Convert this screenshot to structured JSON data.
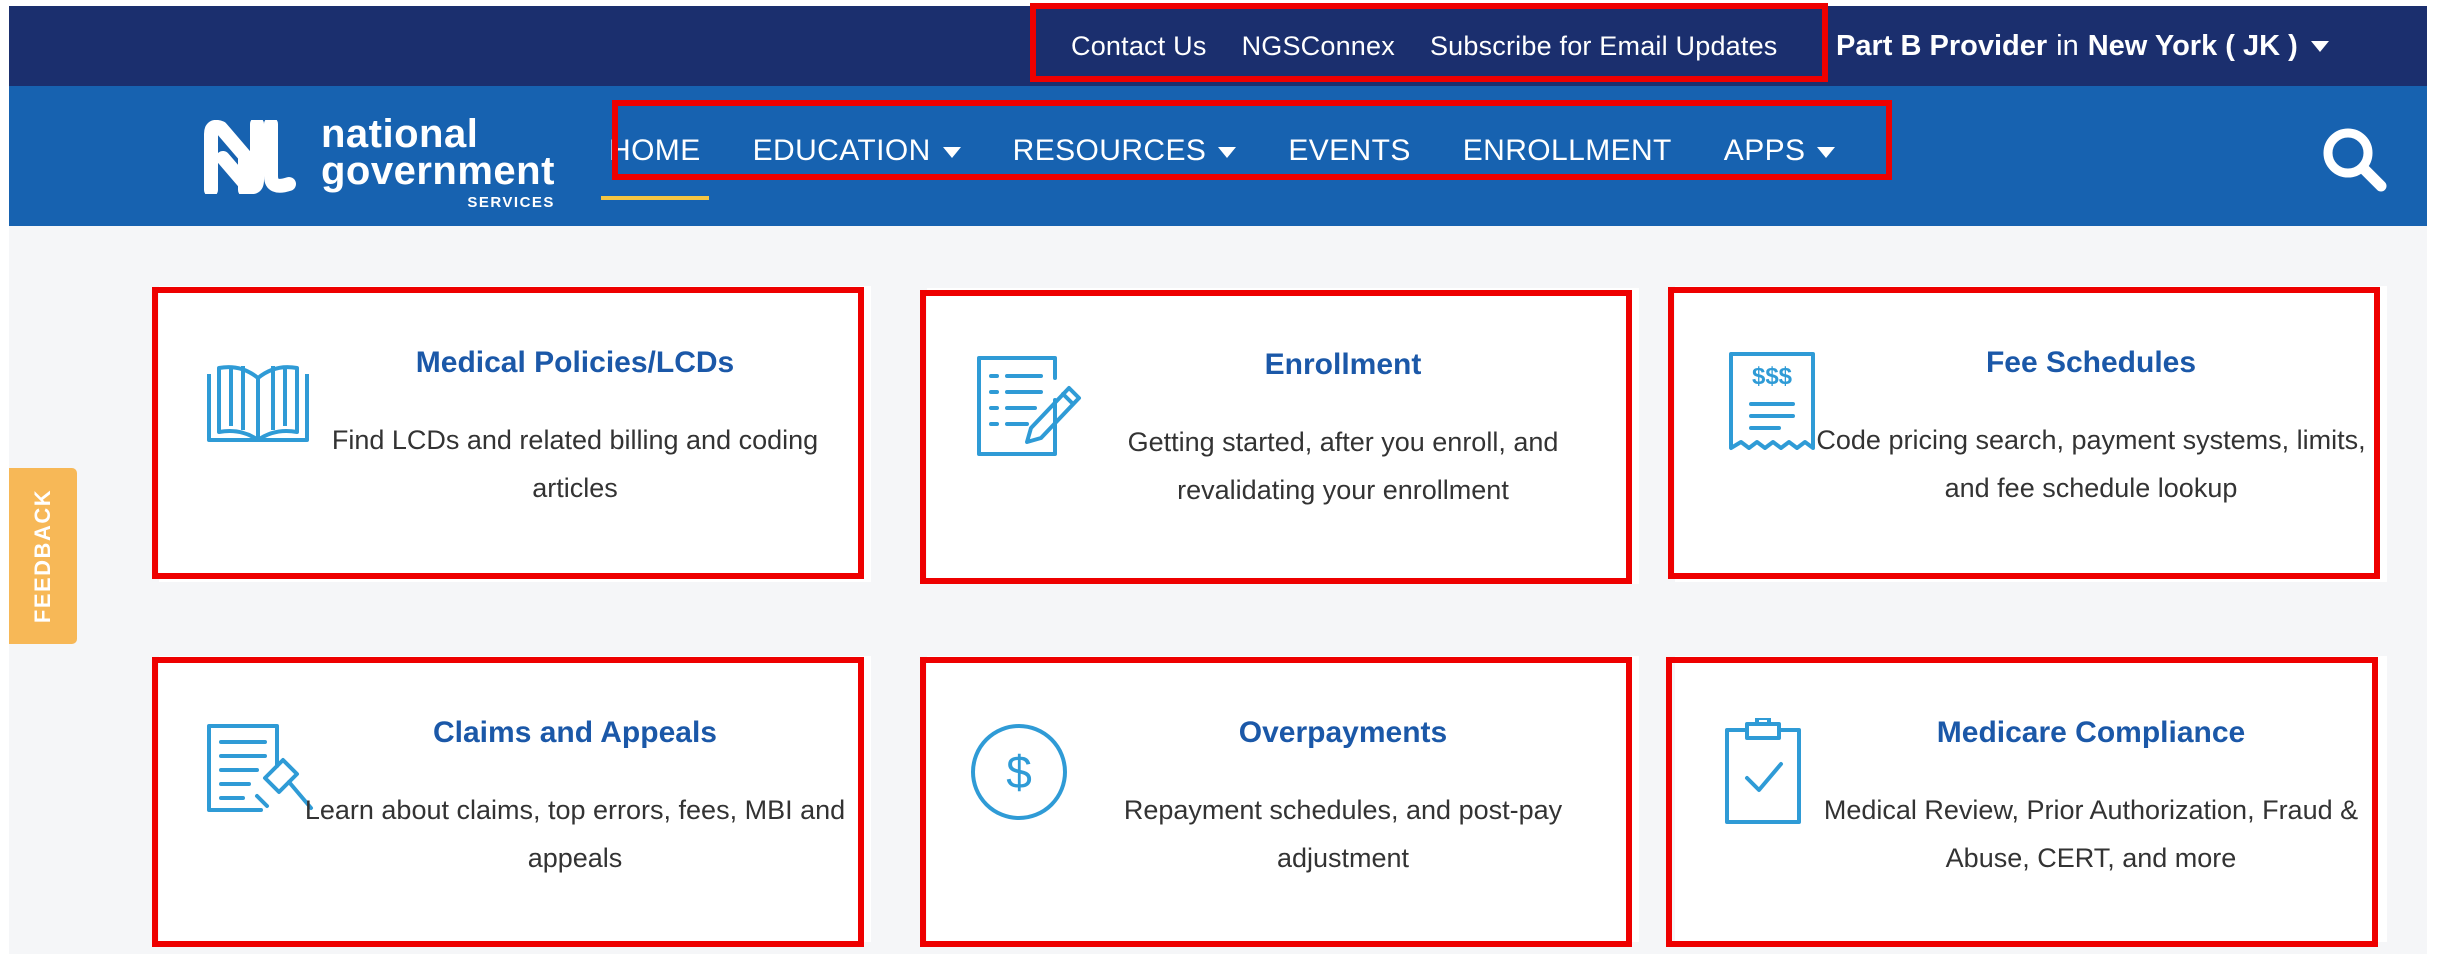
{
  "top_links": [
    "Contact Us",
    "NGSConnex",
    "Subscribe for Email Updates"
  ],
  "provider": {
    "role": "Part B Provider",
    "in_word": "in",
    "region": "New York ( JK )"
  },
  "logo": {
    "line1": "national",
    "line2": "government",
    "line3": "SERVICES"
  },
  "nav": [
    "HOME",
    "EDUCATION",
    "RESOURCES",
    "EVENTS",
    "ENROLLMENT",
    "APPS"
  ],
  "nav_dropdown": [
    false,
    true,
    true,
    false,
    false,
    true
  ],
  "active_nav": "HOME",
  "feedback": "FEEDBACK",
  "cards": [
    {
      "title": "Medical Policies/LCDs",
      "desc": "Find LCDs and related billing and coding articles",
      "icon": "book-icon"
    },
    {
      "title": "Enrollment",
      "desc": "Getting started, after you enroll, and revalidating your enrollment",
      "icon": "form-pencil-icon"
    },
    {
      "title": "Fee Schedules",
      "desc": "Code pricing search, payment systems, limits, and fee schedule lookup",
      "icon": "receipt-icon"
    },
    {
      "title": "Claims and Appeals",
      "desc": "Learn about claims, top errors, fees, MBI and appeals",
      "icon": "document-gavel-icon"
    },
    {
      "title": "Overpayments",
      "desc": "Repayment schedules, and post-pay adjustment",
      "icon": "dollar-circle-icon"
    },
    {
      "title": "Medicare Compliance",
      "desc": "Medical Review, Prior Authorization, Fraud & Abuse, CERT, and more",
      "icon": "clipboard-check-icon"
    }
  ],
  "colors": {
    "top_bar": "#1b2f6e",
    "nav_bar": "#1762b0",
    "card_title": "#1b58a8",
    "icon": "#2f9bd6",
    "active_underline": "#f4c542",
    "feedback": "#f7b857",
    "annotation": "#ee0000"
  }
}
